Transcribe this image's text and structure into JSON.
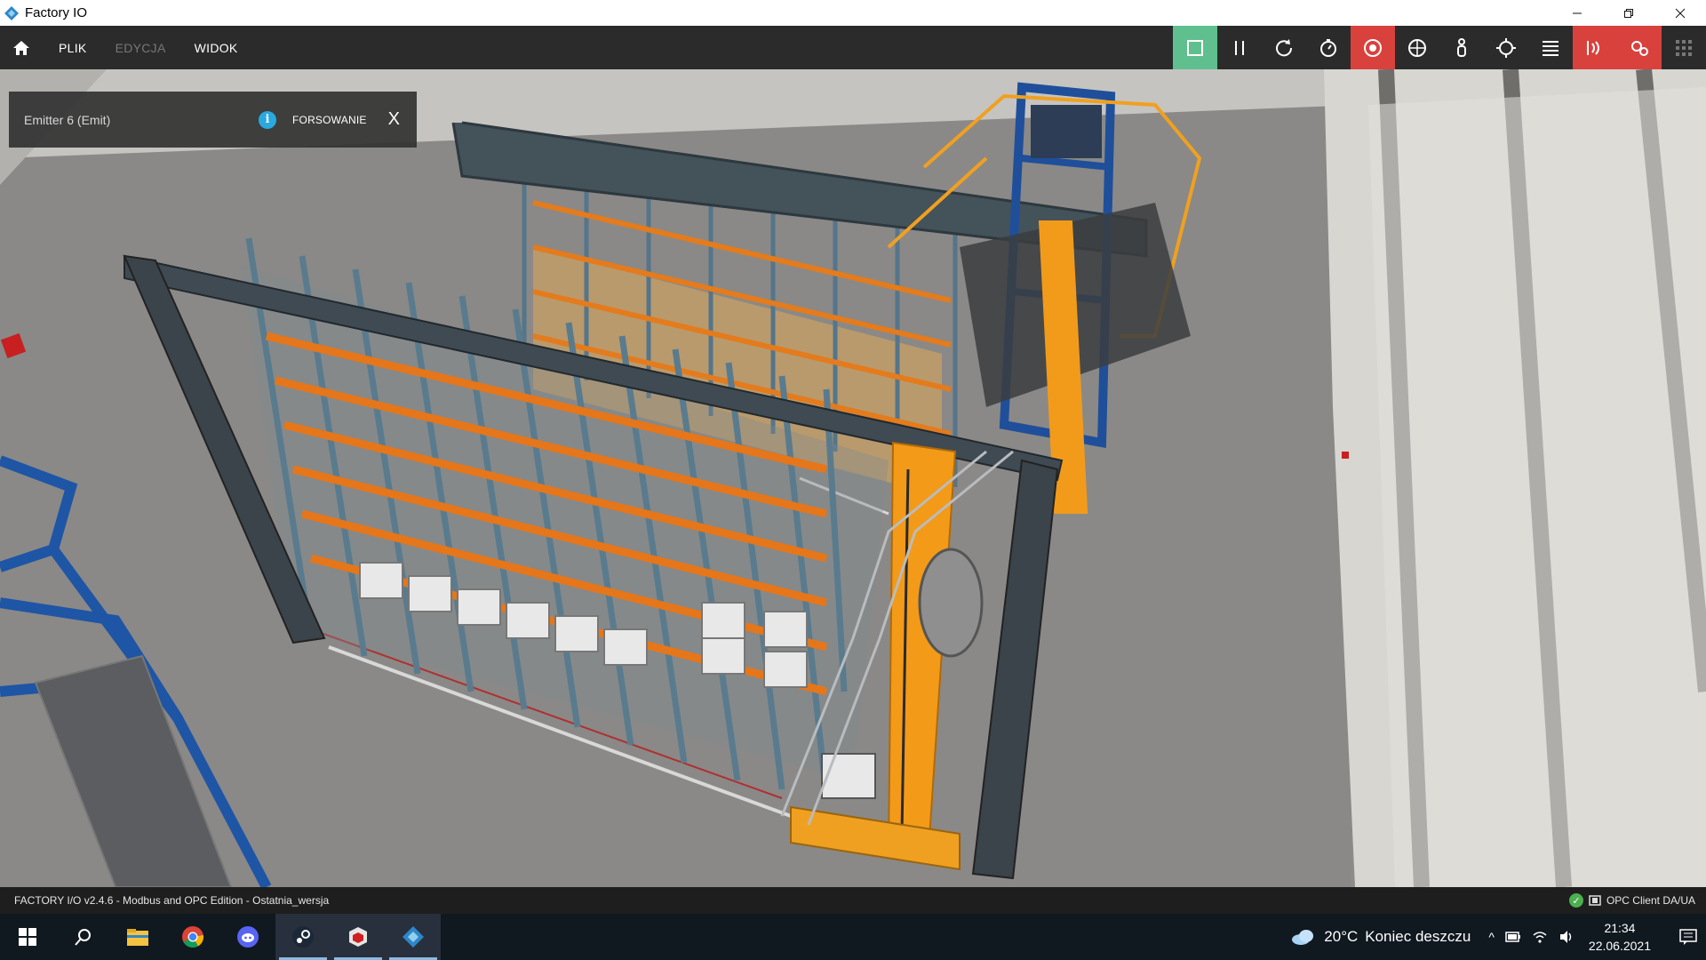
{
  "window": {
    "title": "Factory IO"
  },
  "menu": {
    "items": [
      {
        "label": "PLIK",
        "enabled": true
      },
      {
        "label": "EDYCJA",
        "enabled": false
      },
      {
        "label": "WIDOK",
        "enabled": true
      }
    ]
  },
  "toolbar": {
    "buttons": [
      {
        "name": "stop-icon",
        "state": "active-green"
      },
      {
        "name": "pause-icon",
        "state": "normal"
      },
      {
        "name": "reset-icon",
        "state": "normal"
      },
      {
        "name": "timer-icon",
        "state": "normal"
      },
      {
        "name": "camera-orbit-icon",
        "state": "active-red"
      },
      {
        "name": "fly-camera-icon",
        "state": "normal"
      },
      {
        "name": "first-person-icon",
        "state": "normal"
      },
      {
        "name": "crosshair-icon",
        "state": "normal"
      },
      {
        "name": "list-icon",
        "state": "normal"
      },
      {
        "name": "sensor-icon",
        "state": "active-red"
      },
      {
        "name": "drivers-icon",
        "state": "active-red"
      },
      {
        "name": "grid-icon",
        "state": "normal"
      }
    ],
    "colors": {
      "green": "#5fbf8f",
      "red": "#d9413d"
    }
  },
  "popup": {
    "title": "Emitter 6 (Emit)",
    "info_glyph": "i",
    "force_label": "FORSOWANIE",
    "close_glyph": "X"
  },
  "status": {
    "text": "FACTORY I/O v2.4.6 - Modbus and OPC Edition - Ostatnia_wersja",
    "driver": "OPC Client DA/UA"
  },
  "taskbar": {
    "apps": [
      "windows-start-icon",
      "search-icon",
      "file-explorer-icon",
      "chrome-icon",
      "discord-icon",
      "steam-icon",
      "cube-app-icon",
      "factory-io-icon"
    ],
    "weather_temp": "20°C",
    "weather_desc": "Koniec deszczu",
    "time": "21:34",
    "date": "22.06.2021"
  }
}
